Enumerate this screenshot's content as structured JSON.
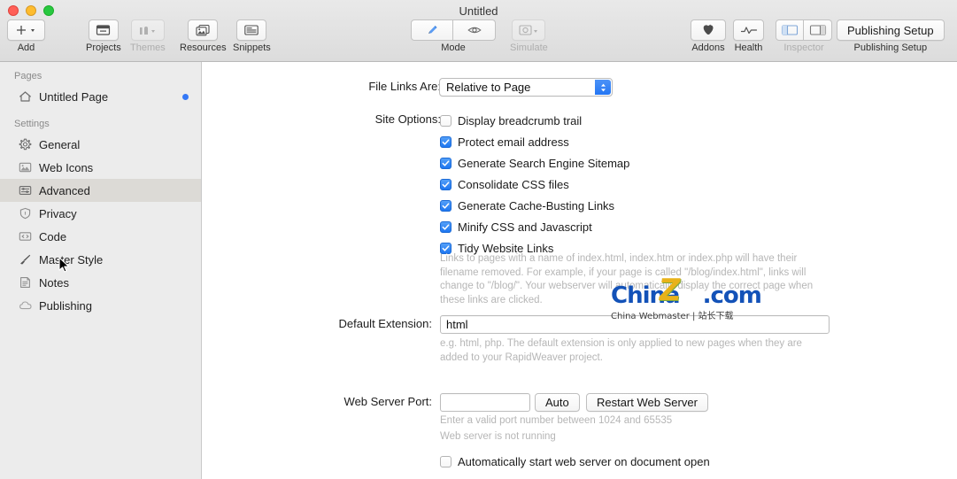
{
  "window": {
    "title": "Untitled",
    "traffic_lights": [
      "close",
      "minimize",
      "zoom"
    ]
  },
  "toolbar": {
    "add": {
      "label": "Add",
      "icon": "plus-icon"
    },
    "projects": {
      "label": "Projects",
      "icon": "projects-icon"
    },
    "themes": {
      "label": "Themes",
      "icon": "themes-icon",
      "disabled": true
    },
    "resources": {
      "label": "Resources",
      "icon": "resources-icon"
    },
    "snippets": {
      "label": "Snippets",
      "icon": "snippets-icon"
    },
    "mode": {
      "label": "Mode",
      "edit_icon": "pencil-icon",
      "preview_icon": "eye-icon"
    },
    "simulate": {
      "label": "Simulate",
      "icon": "simulate-icon",
      "disabled": true
    },
    "addons": {
      "label": "Addons",
      "icon": "addons-icon"
    },
    "health": {
      "label": "Health",
      "icon": "health-pulse-icon"
    },
    "inspector": {
      "label": "Inspector",
      "icon_left": "sidebar-left-icon",
      "icon_right": "sidebar-right-icon",
      "disabled": true
    },
    "publishing_setup": {
      "button_label": "Publishing Setup",
      "label": "Publishing Setup"
    }
  },
  "sidebar": {
    "pages_header": "Pages",
    "pages": [
      {
        "label": "Untitled Page",
        "icon": "home-icon",
        "has_dot": true
      }
    ],
    "settings_header": "Settings",
    "settings": [
      {
        "label": "General",
        "icon": "gear-icon",
        "selected": false
      },
      {
        "label": "Web Icons",
        "icon": "image-icon",
        "selected": false
      },
      {
        "label": "Advanced",
        "icon": "sliders-icon",
        "selected": true
      },
      {
        "label": "Privacy",
        "icon": "shield-icon",
        "selected": false
      },
      {
        "label": "Code",
        "icon": "code-icon",
        "selected": false
      },
      {
        "label": "Master Style",
        "icon": "brush-icon",
        "selected": false
      },
      {
        "label": "Notes",
        "icon": "notes-icon",
        "selected": false
      },
      {
        "label": "Publishing",
        "icon": "cloud-icon",
        "selected": false
      }
    ]
  },
  "main": {
    "file_links": {
      "label": "File Links Are:",
      "value": "Relative to Page"
    },
    "site_options": {
      "label": "Site Options:",
      "checkboxes": [
        {
          "label": "Display breadcrumb trail",
          "checked": false
        },
        {
          "label": "Protect email address",
          "checked": true
        },
        {
          "label": "Generate Search Engine Sitemap",
          "checked": true
        },
        {
          "label": "Consolidate CSS files",
          "checked": true
        },
        {
          "label": "Generate Cache-Busting Links",
          "checked": true
        },
        {
          "label": "Minify CSS and Javascript",
          "checked": true
        },
        {
          "label": "Tidy Website Links",
          "checked": true
        }
      ],
      "help": "Links to pages with a name of index.html, index.htm or index.php will have their filename removed. For example, if your page is called \"/blog/index.html\", links will change to \"/blog/\". Your webserver will automatically display the correct page when these links are clicked."
    },
    "default_extension": {
      "label": "Default Extension:",
      "value": "html",
      "help": "e.g. html, php. The default extension is only applied to new pages when they are added to your RapidWeaver project."
    },
    "web_server_port": {
      "label": "Web Server Port:",
      "value": "",
      "placeholder": "",
      "auto_button": "Auto",
      "restart_button": "Restart Web Server",
      "help": "Enter a valid port number between 1024 and 65535",
      "status": "Web server is not running",
      "auto_start_checkbox": {
        "label": "Automatically start web server on document open",
        "checked": false
      }
    }
  },
  "watermark": {
    "main_text": "China",
    "logo_letter": "Z",
    "suffix": ".com",
    "subtitle": "China Webmaster | 站长下载"
  },
  "colors": {
    "accent_blue": "#1e76f1",
    "selection_gray": "#dcdad6",
    "sidebar_bg": "#ececec",
    "toolbar_bg": "#e3e3e3",
    "help_text": "#b6b6b6"
  }
}
